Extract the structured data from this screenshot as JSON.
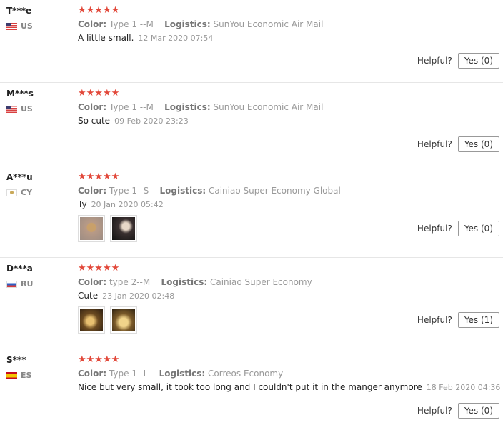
{
  "reviews": [
    {
      "user": "T***e",
      "country": "US",
      "stars": "★★★★★",
      "color_label": "Color:",
      "color": "Type 1 --M",
      "logistics_label": "Logistics:",
      "logistics": "SunYou Economic Air Mail",
      "text": "A little small.",
      "date": "12 Mar 2020 07:54",
      "helpful_label": "Helpful?",
      "yes": "Yes (0)"
    },
    {
      "user": "M***s",
      "country": "US",
      "stars": "★★★★★",
      "color_label": "Color:",
      "color": "Type 1 --M",
      "logistics_label": "Logistics:",
      "logistics": "SunYou Economic Air Mail",
      "text": "So cute",
      "date": "09 Feb 2020 23:23",
      "helpful_label": "Helpful?",
      "yes": "Yes (0)"
    },
    {
      "user": "A***u",
      "country": "CY",
      "stars": "★★★★★",
      "color_label": "Color:",
      "color": "Type 1--S",
      "logistics_label": "Logistics:",
      "logistics": "Cainiao Super Economy Global",
      "text": "Ty",
      "date": "20 Jan 2020 05:42",
      "helpful_label": "Helpful?",
      "yes": "Yes (0)"
    },
    {
      "user": "D***a",
      "country": "RU",
      "stars": "★★★★★",
      "color_label": "Color:",
      "color": "type 2--M",
      "logistics_label": "Logistics:",
      "logistics": "Cainiao Super Economy",
      "text": "Cute",
      "date": "23 Jan 2020 02:48",
      "helpful_label": "Helpful?",
      "yes": "Yes (1)"
    },
    {
      "user": "S***",
      "country": "ES",
      "stars": "★★★★★",
      "color_label": "Color:",
      "color": "Type 1--L",
      "logistics_label": "Logistics:",
      "logistics": "Correos Economy",
      "text": "Nice but very small, it took too long and I couldn't put it in the manger anymore",
      "date": "18 Feb 2020 04:36",
      "helpful_label": "Helpful?",
      "yes": "Yes (0)"
    }
  ]
}
